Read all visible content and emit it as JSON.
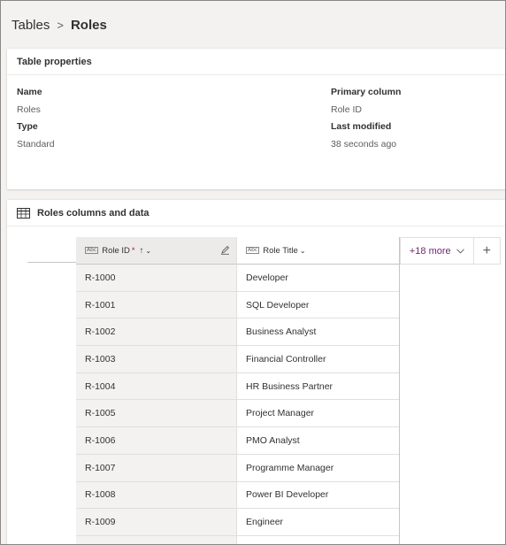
{
  "breadcrumb": {
    "parent": "Tables",
    "separator": ">",
    "current": "Roles"
  },
  "properties": {
    "header": "Table properties",
    "name_label": "Name",
    "name_value": "Roles",
    "type_label": "Type",
    "type_value": "Standard",
    "primary_label": "Primary column",
    "primary_value": "Role ID",
    "modified_label": "Last modified",
    "modified_value": "38 seconds ago"
  },
  "data_section": {
    "header": "Roles columns and data",
    "columns": {
      "id": {
        "label": "Role ID",
        "required": "*",
        "sort": "↑",
        "chevron": "⌄"
      },
      "title": {
        "label": "Role Title",
        "chevron": "⌄"
      }
    },
    "more_label": "+18 more",
    "add_label": "+",
    "rows": [
      {
        "id": "R-1000",
        "title": "Developer"
      },
      {
        "id": "R-1001",
        "title": "SQL Developer"
      },
      {
        "id": "R-1002",
        "title": "Business Analyst"
      },
      {
        "id": "R-1003",
        "title": "Financial Controller"
      },
      {
        "id": "R-1004",
        "title": "HR Business Partner"
      },
      {
        "id": "R-1005",
        "title": "Project Manager"
      },
      {
        "id": "R-1006",
        "title": "PMO Analyst"
      },
      {
        "id": "R-1007",
        "title": "Programme Manager"
      },
      {
        "id": "R-1008",
        "title": "Power BI Developer"
      },
      {
        "id": "R-1009",
        "title": "Engineer"
      }
    ]
  },
  "colors": {
    "accent": "#742774",
    "required": "#a4262c"
  }
}
